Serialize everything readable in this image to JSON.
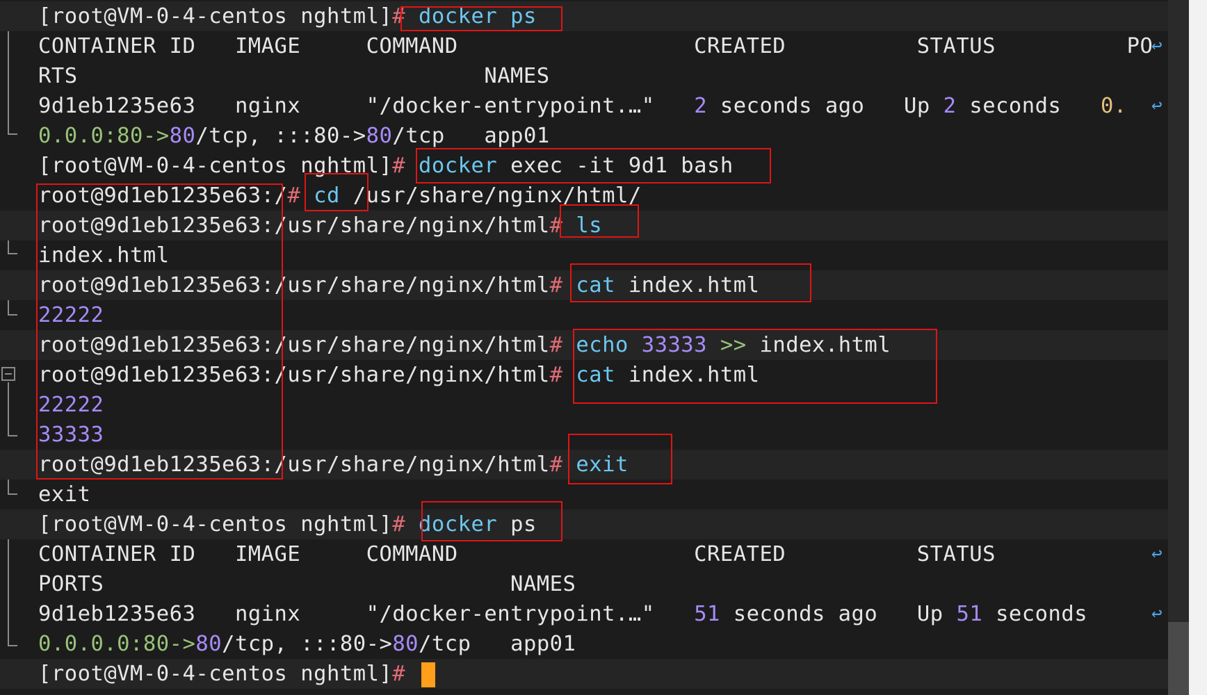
{
  "terminal": {
    "prompt_host": "[root@VM-0-4-centos nghtml]",
    "prompt_container_root": "root@9d1eb1235e63:/",
    "prompt_container_html": "root@9d1eb1235e63:/usr/share/nginx/html",
    "hash": "#",
    "lines": {
      "l1_cmd": "docker ps",
      "l2_header": "CONTAINER ID   IMAGE     COMMAND                  CREATED          STATUS          PO",
      "l3_header_cont": "RTS                               NAMES",
      "l4_id": "9d1eb1235e63",
      "l4_image": "nginx",
      "l4_command": "\"/docker-entrypoint.…\"",
      "l4_created_num": "2",
      "l4_created_rest": " seconds ago",
      "l4_status_up": "Up ",
      "l4_status_num": "2",
      "l4_status_rest": " seconds",
      "l4_ports_start": "0.",
      "l5_ports_a": "0.0.0:80->",
      "l5_ports_b": "80",
      "l5_ports_c": "/tcp, :::80->",
      "l5_ports_d": "80",
      "l5_ports_e": "/tcp",
      "l5_name": "app01",
      "l6_cmd_a": "docker",
      "l6_cmd_b": " exec -it 9d1 bash",
      "l7_cmd_a": "cd",
      "l7_cmd_b": " /usr/share/nginx/html/",
      "l8_cmd": "ls",
      "l9_out": "index.html",
      "l10_cmd_a": "cat",
      "l10_cmd_b": " index.html",
      "l11_out": "22222",
      "l12_cmd_a": "echo",
      "l12_cmd_num": "33333",
      "l12_cmd_op": ">>",
      "l12_cmd_b": "index.html",
      "l13_cmd_a": "cat",
      "l13_cmd_b": " index.html",
      "l14_out": "22222",
      "l15_out": "33333",
      "l16_cmd": "exit",
      "l17_out": "exit",
      "l18_cmd_a": "docker",
      "l18_cmd_b": " ps",
      "l19_header": "CONTAINER ID   IMAGE     COMMAND                  CREATED          STATUS",
      "l20_header_cont": "PORTS                               NAMES",
      "l21_id": "9d1eb1235e63",
      "l21_image": "nginx",
      "l21_command": "\"/docker-entrypoint.…\"",
      "l21_created_num": "51",
      "l21_created_rest": " seconds ago",
      "l21_status_up": "Up ",
      "l21_status_num": "51",
      "l21_status_rest": " seconds",
      "l22_ports_a": "0.0.0.0:80->",
      "l22_ports_b": "80",
      "l22_ports_c": "/tcp, :::80->",
      "l22_ports_d": "80",
      "l22_ports_e": "/tcp",
      "l22_name": "app01"
    },
    "wrap_icon": "wrap-arrow-icon",
    "colors": {
      "background": "#1c1c1c",
      "hash": "#e06c75",
      "command": "#6cc7f0",
      "number": "#a78bfa",
      "ports": "#98c379",
      "cursor": "#ff9f1a",
      "annotation_box": "#e01515"
    }
  }
}
